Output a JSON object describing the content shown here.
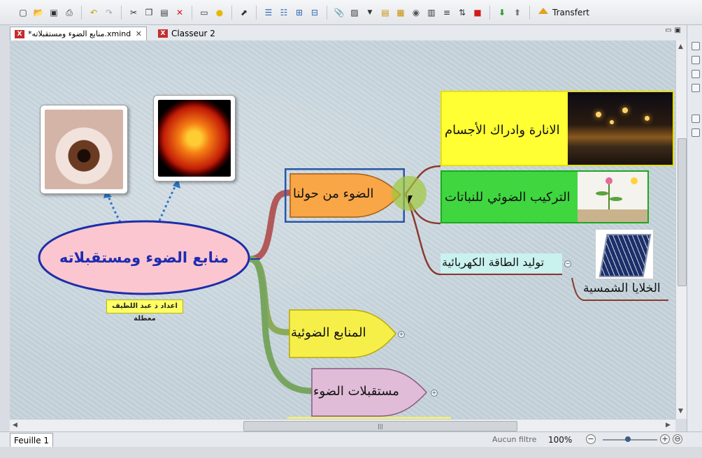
{
  "toolbar": {
    "icons": [
      "new-icon",
      "open-icon",
      "save-icon",
      "print-icon",
      "undo-icon",
      "redo-icon",
      "cut-icon",
      "copy-icon",
      "paste-icon",
      "delete-icon",
      "presentation-icon",
      "idea-icon",
      "export-icon",
      "topic-icon",
      "subtopic-icon",
      "detach-icon",
      "relationship-icon",
      "attachment-icon",
      "image-icon",
      "boundary-icon",
      "note-icon",
      "marker-icon",
      "summary-icon",
      "label-icon",
      "sort-icon",
      "stop-icon",
      "drill-down-icon",
      "drill-up-icon"
    ],
    "transfer_label": "Transfert"
  },
  "tabs": [
    {
      "label": "*منابع الضوء ومستقبلاته.xmind",
      "active": true
    },
    {
      "label": "Classeur 2",
      "active": false
    }
  ],
  "map": {
    "central_topic": "منابع الضوء ومستقبلاته",
    "author_label": "اعداد ذ عبد اللطيف معطلة",
    "branches": [
      {
        "label": "الضوء من حولنا",
        "color": "#f8a646"
      },
      {
        "label": "المنابع الضوئية",
        "color": "#f6ef4a"
      },
      {
        "label": "مستقبلات الضوء",
        "color": "#e0bcd8"
      }
    ],
    "subtopics": [
      {
        "label": "الانارة وادراك الأجسام",
        "color": "#ffff33"
      },
      {
        "label": "التركيب الضوئي للنباتات",
        "color": "#3fd63f"
      },
      {
        "label": "توليد الطاقة الكهربائية",
        "color": "#c9f2ef"
      }
    ],
    "solar_cells_label": "الخلايا الشمسية"
  },
  "statusbar": {
    "sheet_tab": "Feuille 1",
    "filter": "Aucun filtre",
    "zoom": "100%"
  }
}
